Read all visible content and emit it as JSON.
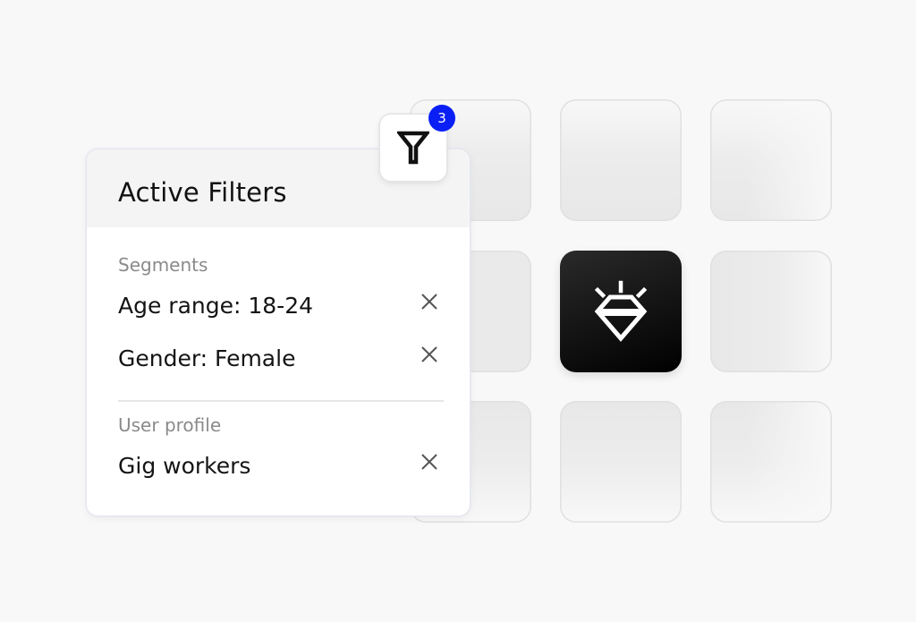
{
  "filters_panel": {
    "title": "Active Filters",
    "badge_count": "3",
    "sections": [
      {
        "label": "Segments",
        "items": [
          {
            "label": "Age range: 18-24",
            "remove_icon": "close-icon"
          },
          {
            "label": "Gender: Female",
            "remove_icon": "close-icon"
          }
        ]
      },
      {
        "label": "User profile",
        "items": [
          {
            "label": "Gig workers",
            "remove_icon": "close-icon"
          }
        ]
      }
    ]
  },
  "filter_button": {
    "icon": "filter-funnel-icon"
  },
  "app_tiles": {
    "featured_icon": "diamond-sparkle-icon"
  },
  "colors": {
    "badge": "#0a1ff5",
    "featured_tile": "#000000",
    "page_background": "#f8f8f8",
    "header_background": "#f4f4f5"
  }
}
